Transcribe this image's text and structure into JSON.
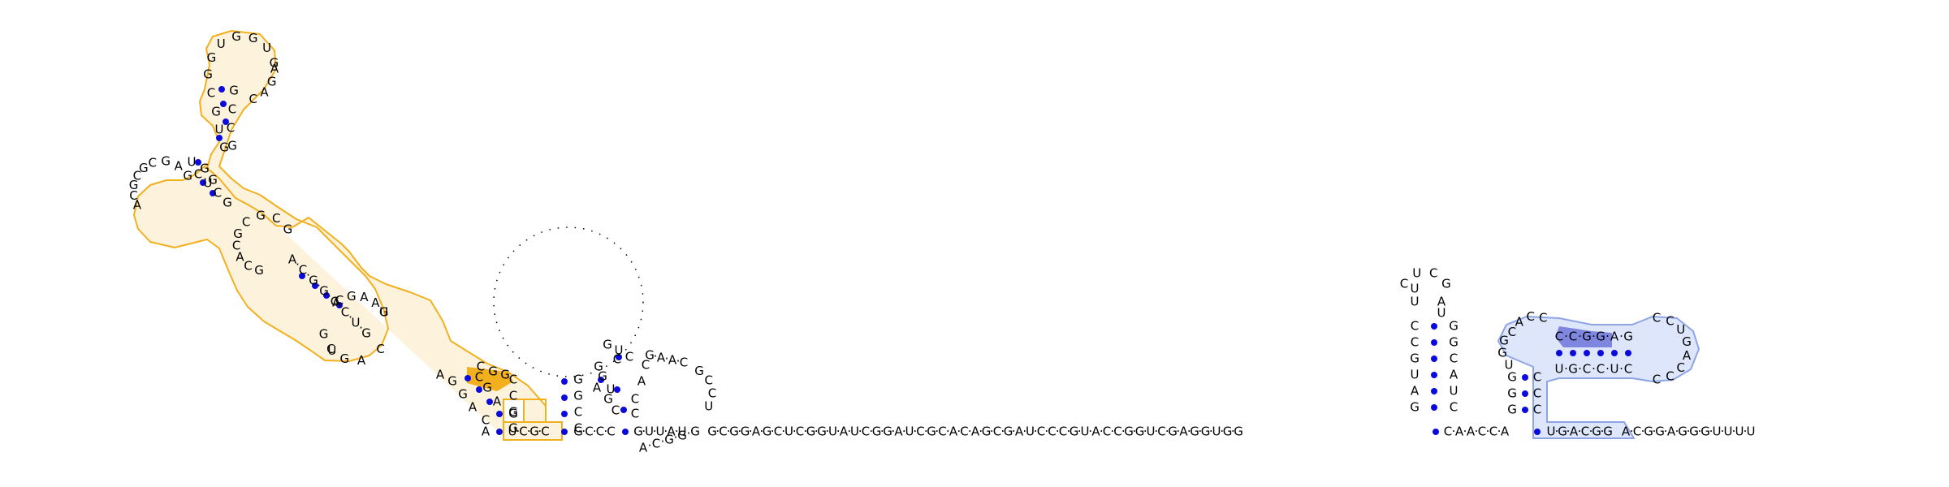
{
  "colors": {
    "background": "#ffffff",
    "nucleotide_text": "#000000",
    "base_pair_dot": "#0a0adc",
    "orange_outline": "#f2b01e",
    "orange_fill": "#fdf3dc",
    "orange_highlight": "#f2b01e",
    "blue_outline": "#8fa4e6",
    "blue_fill": "#dde6fb",
    "blue_highlight": "#7f86e0",
    "pseudoknot_dots": "#000000"
  },
  "strands": {
    "backbone": "G-C-G-G-A-G-C-U-C-G-G-U-A-U-C-G-G-A-U-C-G-C-A-C-A-G-C-G-A-U-C-C-C-G-U-A-C-C-G-G-U-C-G-A-G-G-U-G-G",
    "tail_right": "C-A-A-C-C-A",
    "blue_bottom": "U-G-A-C-G-G",
    "three_prime_tail": "A-C-G-G-A-G-G-G-U-U-U-U",
    "left_bottom_a": "A",
    "orange_loop_bottom": "U-C-G-C",
    "middle_bottom": "G-C-C-C",
    "second_bottom": "G-U-U-A-U",
    "second_loop": "A-C-G-G-G",
    "orange_top_loop": "G-U-G-G-U-G",
    "orange_left_loop": "C-G-A-G",
    "orange_mid_left": "A-C-G-C-G",
    "orange_mid_top": "C-G-C-G",
    "orange_branch": "A-C-G-G-C-C-U-G",
    "orange_big_loop": "C-G-A-A-U",
    "orange_big_loop_bottom": "A-G-C-G",
    "hairpin_loop": "C-U-C-G",
    "blue_loop": "C-C-U-G-A-C-C-C",
    "blue_inner_top": "C-C-G-G-A-G",
    "blue_inner_bottom": "U-G-C-C-U-C",
    "blue_left_loop": "C-A-C-C"
  }
}
